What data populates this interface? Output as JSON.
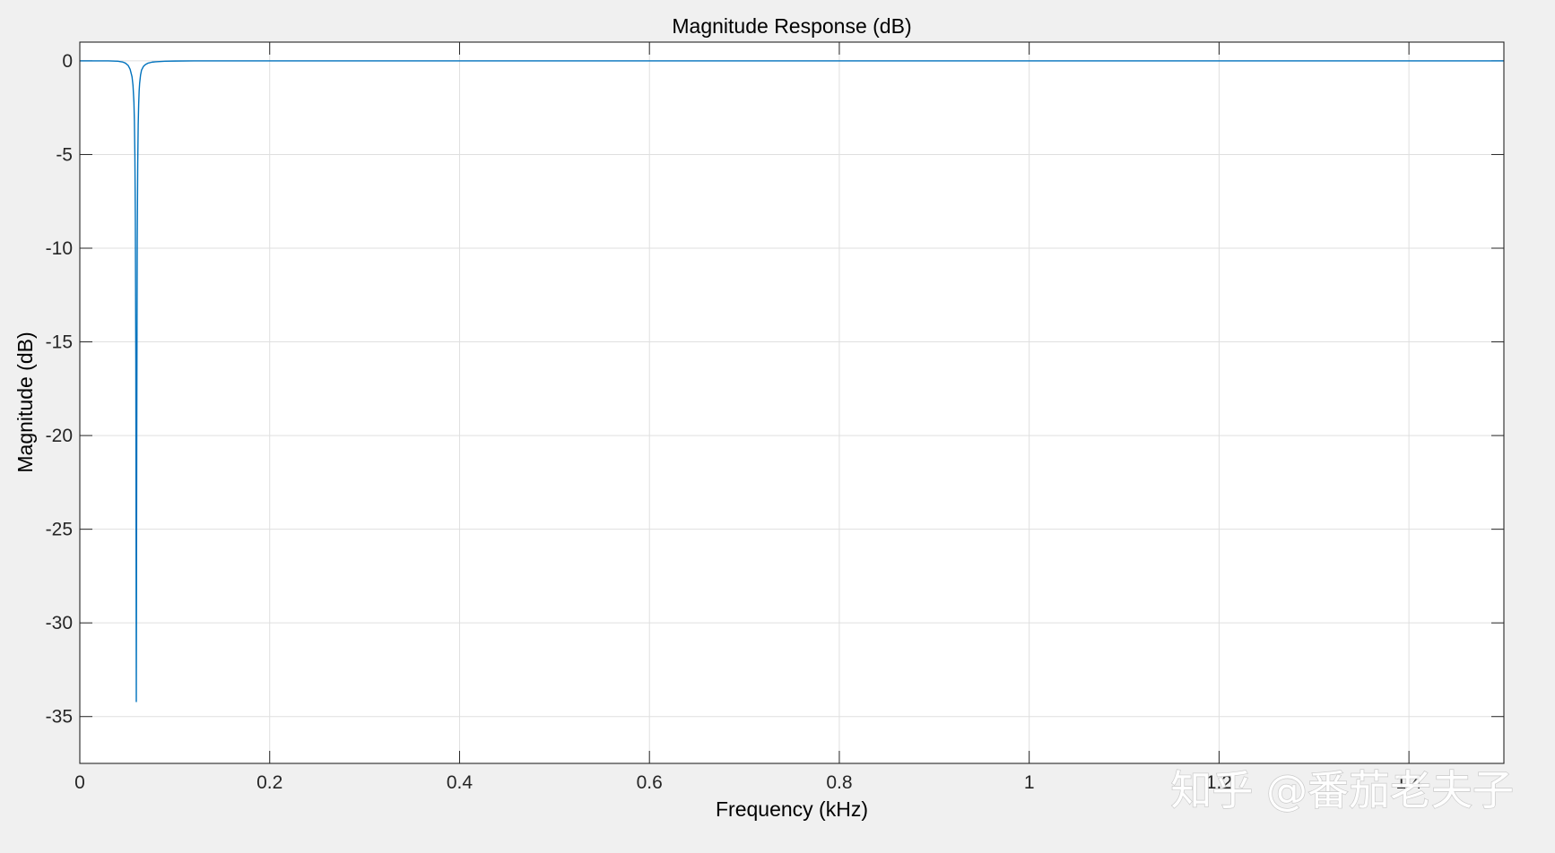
{
  "chart_data": {
    "type": "line",
    "title": "Magnitude Response (dB)",
    "xlabel": "Frequency (kHz)",
    "ylabel": "Magnitude (dB)",
    "xlim": [
      0,
      1.5
    ],
    "ylim": [
      -37.5,
      1
    ],
    "xticks": [
      0,
      0.2,
      0.4,
      0.6,
      0.8,
      1,
      1.2,
      1.4
    ],
    "xtick_labels": [
      "0",
      "0.2",
      "0.4",
      "0.6",
      "0.8",
      "1",
      "1.2",
      "1.4"
    ],
    "yticks": [
      0,
      -5,
      -10,
      -15,
      -20,
      -25,
      -30,
      -35
    ],
    "ytick_labels": [
      "0",
      "-5",
      "-10",
      "-15",
      "-20",
      "-25",
      "-30",
      "-35"
    ],
    "grid": true,
    "series": [
      {
        "color": "#0072bd",
        "x": [
          0,
          0.03,
          0.04,
          0.045,
          0.048,
          0.051,
          0.053,
          0.055,
          0.056,
          0.057,
          0.0575,
          0.058,
          0.0585,
          0.059,
          0.0595,
          0.06,
          0.0605,
          0.061,
          0.0615,
          0.062,
          0.0625,
          0.063,
          0.064,
          0.065,
          0.067,
          0.069,
          0.072,
          0.076,
          0.08,
          0.09,
          0.1,
          0.12,
          0.2,
          0.4,
          0.6,
          0.8,
          1,
          1.2,
          1.4,
          1.5
        ],
        "y": [
          0,
          0,
          -0.02,
          -0.06,
          -0.12,
          -0.25,
          -0.45,
          -0.85,
          -1.3,
          -2.2,
          -3.2,
          -5,
          -8.5,
          -16,
          -34.2,
          -20,
          -9.5,
          -5.5,
          -3.4,
          -2.3,
          -1.6,
          -1.2,
          -0.75,
          -0.5,
          -0.3,
          -0.2,
          -0.12,
          -0.07,
          -0.05,
          -0.02,
          -0.01,
          0,
          0,
          0,
          0,
          0,
          0,
          0,
          0,
          0
        ]
      }
    ]
  },
  "watermark": {
    "text": "知乎 @番茄老夫子"
  }
}
